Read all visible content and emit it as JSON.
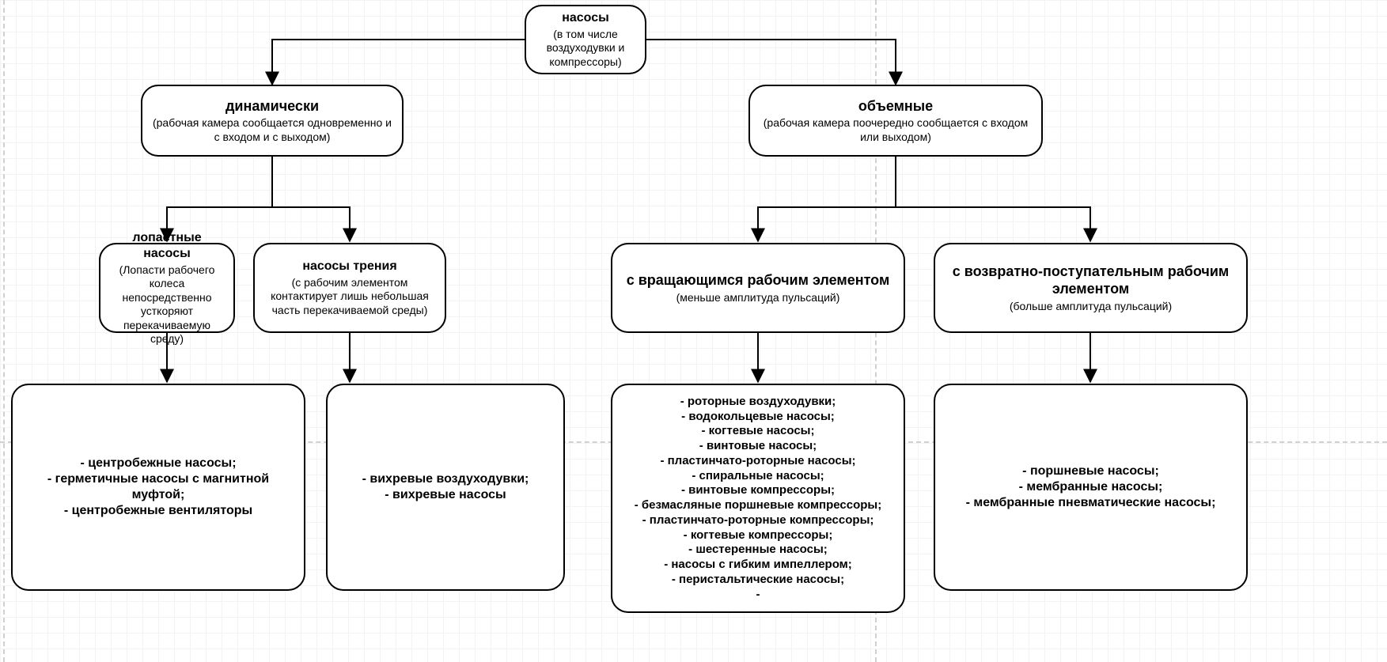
{
  "root": {
    "title": "насосы",
    "sub": "(в том числе воздуходувки и компрессоры)"
  },
  "dynamic": {
    "title": "динамически",
    "sub": "(рабочая камера сообщается одновременно и с входом и с выходом)"
  },
  "volumetric": {
    "title": "объемные",
    "sub": "(рабочая камера поочередно сообщается с входом или выходом)"
  },
  "vane": {
    "title": "лопастные насосы",
    "sub": "(Лопасти рабочего колеса непосредственно усткоряют перекачиваемую среду)"
  },
  "friction": {
    "title": "насосы трения",
    "sub": "(с рабочим элементом контактирует лишь небольшая часть перекачиваемой среды)"
  },
  "rotary": {
    "title": "с вращающимся рабочим элементом",
    "sub": "(меньше амплитуда пульсаций)"
  },
  "recip": {
    "title": "с возвратно-поступательным рабочим элементом",
    "sub": "(больше амплитуда пульсаций)"
  },
  "vane_examples": "- центробежные насосы;\n- герметичные насосы с магнитной муфтой;\n- центробежные вентиляторы",
  "friction_examples": "- вихревые воздуходувки;\n- вихревые насосы",
  "rotary_examples": "- роторные воздуходувки;\n- водокольцевые насосы;\n- когтевые насосы;\n- винтовые насосы;\n- пластинчато-роторные насосы;\n- спиральные насосы;\n- винтовые компрессоры;\n- безмасляные поршневые компрессоры;\n- пластинчато-роторные компрессоры;\n- когтевые компрессоры;\n- шестеренные насосы;\n- насосы с гибким импеллером;\n- перистальтические насосы;\n-",
  "recip_examples": "- поршневые насосы;\n- мембранные насосы;\n- мембранные пневматические насосы;"
}
